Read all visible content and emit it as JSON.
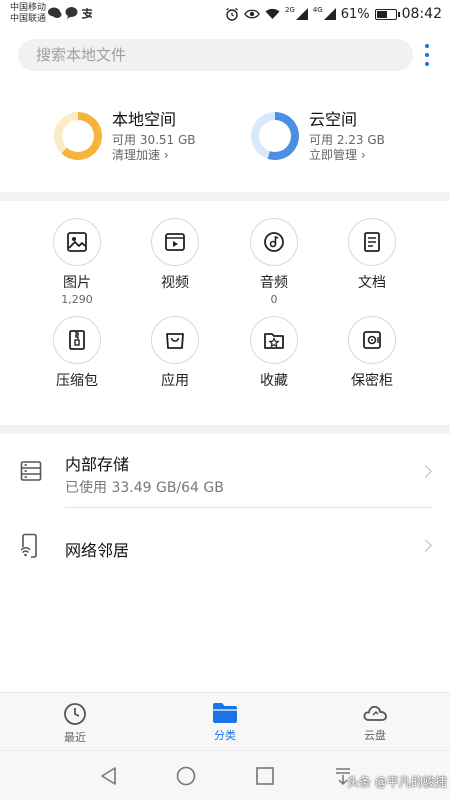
{
  "status_bar": {
    "carrier1": "中国移动",
    "carrier2": "中国联通",
    "battery_pct": "61%",
    "time": "08:42",
    "network_a": "2G",
    "network_b": "4G",
    "battery_level": 0.61
  },
  "search": {
    "placeholder": "搜索本地文件"
  },
  "storage": {
    "local": {
      "title": "本地空间",
      "available": "可用 30.51 GB",
      "action": "清理加速",
      "color": "#f5b43c"
    },
    "cloud": {
      "title": "云空间",
      "available": "可用 2.23 GB",
      "action": "立即管理",
      "color": "#4a90e2"
    }
  },
  "categories": [
    {
      "label": "图片",
      "count": "1,290"
    },
    {
      "label": "视频",
      "count": ""
    },
    {
      "label": "音频",
      "count": "0"
    },
    {
      "label": "文档",
      "count": ""
    },
    {
      "label": "压缩包",
      "count": ""
    },
    {
      "label": "应用",
      "count": ""
    },
    {
      "label": "收藏",
      "count": ""
    },
    {
      "label": "保密柜",
      "count": ""
    }
  ],
  "list": {
    "internal": {
      "title": "内部存储",
      "sub": "已使用 33.49 GB/64 GB"
    },
    "network": {
      "title": "网络邻居"
    }
  },
  "tabs": [
    {
      "label": "最近"
    },
    {
      "label": "分类"
    },
    {
      "label": "云盘"
    }
  ],
  "watermark": "头条 @平凡的骏捷",
  "colors": {
    "accent": "#1a73e8",
    "local_ring": "#f5b43c",
    "cloud_ring": "#4a90e2"
  }
}
